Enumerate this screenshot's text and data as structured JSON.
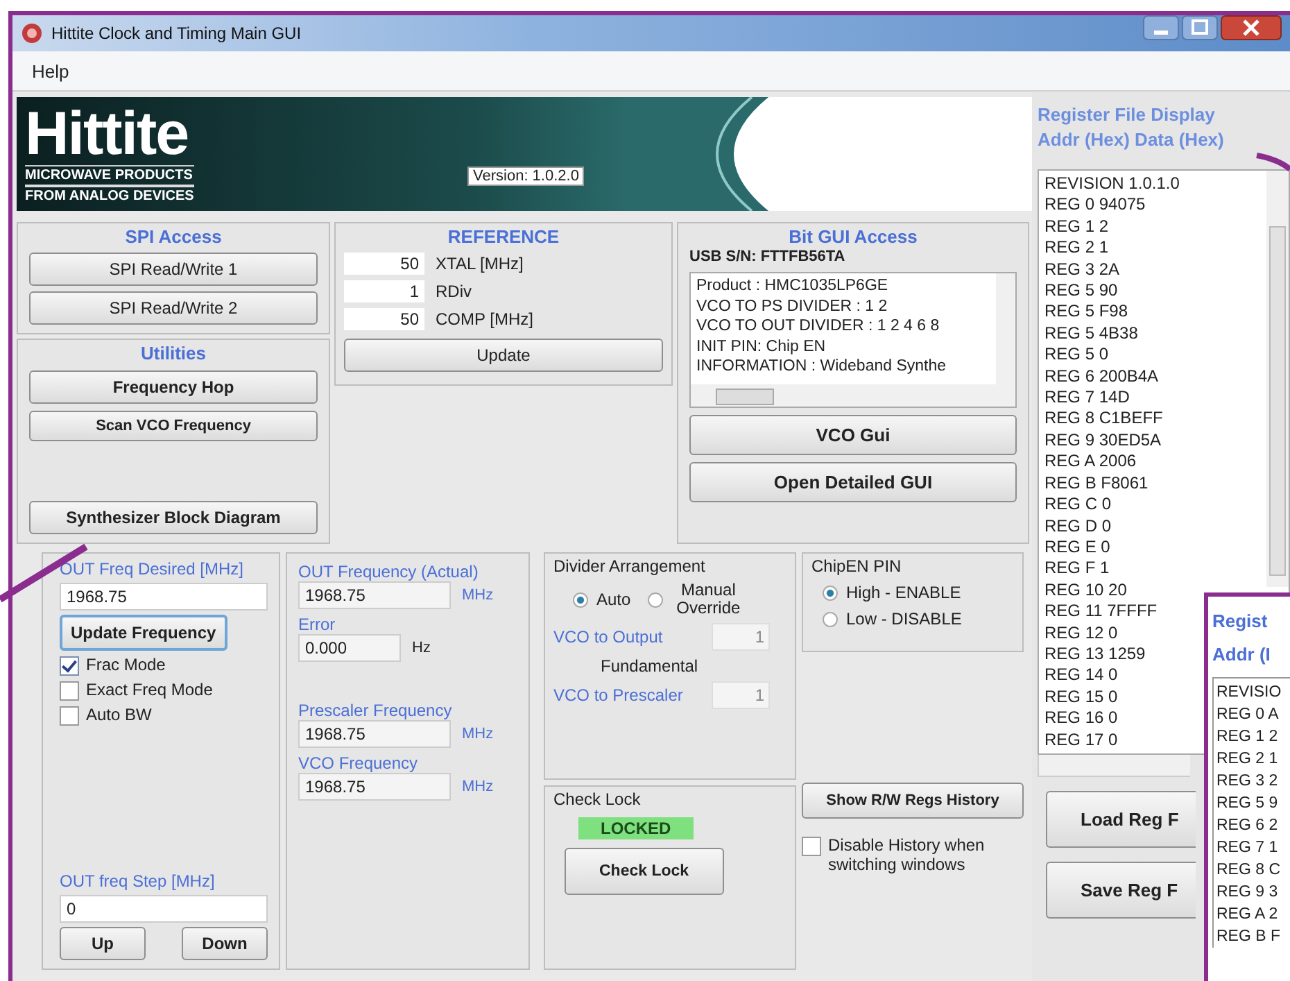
{
  "window": {
    "title": "Hittite Clock and Timing Main GUI"
  },
  "menu": [
    "Help"
  ],
  "banner": {
    "logo": "Hittite",
    "tagline_1": "MICROWAVE PRODUCTS",
    "tagline_2": "FROM ANALOG DEVICES",
    "version_label": "Version:",
    "version": "1.0.2.0"
  },
  "spi_access": {
    "title": "SPI Access",
    "buttons": [
      "SPI Read/Write 1",
      "SPI Read/Write 2"
    ]
  },
  "utilities": {
    "title": "Utilities",
    "buttons": [
      "Frequency Hop",
      "Scan VCO Frequency",
      "Synthesizer Block Diagram"
    ]
  },
  "reference": {
    "title": "REFERENCE",
    "fields": [
      {
        "value": "50",
        "label": "XTAL [MHz]"
      },
      {
        "value": "1",
        "label": "RDiv"
      },
      {
        "value": "50",
        "label": "COMP [MHz]"
      }
    ],
    "button": "Update"
  },
  "bit_gui_access": {
    "title": "Bit GUI Access",
    "usb_sn": "USB S/N: FTTFB56TA",
    "info_lines": [
      "Product : HMC1035LP6GE",
      "VCO TO PS DIVIDER : 1 2",
      "VCO TO OUT DIVIDER : 1 2 4 6 8",
      "INIT PIN: Chip EN",
      "INFORMATION : Wideband Synthe"
    ],
    "buttons": [
      "VCO Gui",
      "Open Detailed GUI"
    ]
  },
  "register_file_display": {
    "title": "Register File Display",
    "header": "Addr (Hex) Data (Hex)",
    "rows": [
      "REVISION 1.0.1.0",
      "REG 0 94075",
      "REG 1 2",
      "REG 2 1",
      "REG 3 2A",
      "REG 5 90",
      "REG 5 F98",
      "REG 5 4B38",
      "REG 5 0",
      "REG 6 200B4A",
      "REG 7 14D",
      "REG 8 C1BEFF",
      "REG 9 30ED5A",
      "REG A 2006",
      "REG B F8061",
      "REG C 0",
      "REG D 0",
      "REG E 0",
      "REG F 1",
      "REG 10 20",
      "REG 11 7FFFF",
      "REG 12 0",
      "REG 13 1259",
      "REG 14 0",
      "REG 15 0",
      "REG 16 0",
      "REG 17 0"
    ],
    "buttons": [
      "Load Reg F",
      "Save Reg F"
    ]
  },
  "out_freq": {
    "label": "OUT Freq Desired [MHz]",
    "value": "1968.75",
    "update_button": "Update Frequency",
    "checkboxes": [
      {
        "label": "Frac Mode",
        "checked": true
      },
      {
        "label": "Exact Freq Mode",
        "checked": false
      },
      {
        "label": "Auto BW",
        "checked": false
      }
    ],
    "step_label": "OUT freq Step [MHz]",
    "step_value": "0",
    "buttons": [
      "Up",
      "Down"
    ]
  },
  "actual": {
    "fields": [
      {
        "label": "OUT Frequency (Actual)",
        "value": "1968.75",
        "unit": "MHz"
      },
      {
        "label": "Error",
        "value": "0.000",
        "unit": "Hz"
      },
      {
        "label": "Prescaler Frequency",
        "value": "1968.75",
        "unit": "MHz"
      },
      {
        "label": "VCO Frequency",
        "value": "1968.75",
        "unit": "MHz"
      }
    ]
  },
  "divider_arrangement": {
    "title": "Divider Arrangement",
    "radios": [
      {
        "label": "Auto",
        "selected": true
      },
      {
        "label": "Manual Override",
        "selected": false
      }
    ],
    "vco_to_output_label": "VCO to Output",
    "vco_to_output_value": "1",
    "mode": "Fundamental",
    "vco_to_prescaler_label": "VCO to Prescaler",
    "vco_to_prescaler_value": "1"
  },
  "chip_en_pin": {
    "title": "ChipEN PIN",
    "radios": [
      {
        "label": "High - ENABLE",
        "selected": true
      },
      {
        "label": "Low - DISABLE",
        "selected": false
      }
    ]
  },
  "check_lock": {
    "title": "Check Lock",
    "status": "LOCKED",
    "locked": true,
    "button": "Check Lock"
  },
  "history": {
    "button": "Show R/W Regs History",
    "checkbox": {
      "label": "Disable History when switching windows",
      "checked": false
    }
  },
  "inset": {
    "title": "Regist",
    "header": "Addr (I",
    "rows": [
      "REVISIO",
      "REG 0 A",
      "REG 1 2",
      "REG 2 1",
      "REG 3 2",
      "REG 5 9",
      "REG 6 2",
      "REG 7 1",
      "REG 8 C",
      "REG 9 3",
      "REG A 2",
      "REG B F"
    ]
  }
}
